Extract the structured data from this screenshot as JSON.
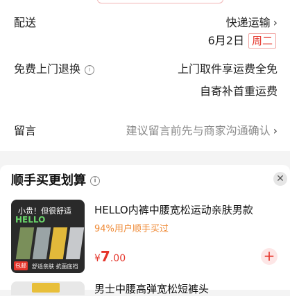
{
  "shipping": {
    "label": "配送",
    "method": "快递运输",
    "date": "6月2日",
    "weekday": "周二"
  },
  "return_service": {
    "label": "免费上门退换",
    "line1": "上门取件享运费全免",
    "line2": "自寄补首重运费"
  },
  "message": {
    "label": "留言",
    "placeholder": "建议留言前先与商家沟通确认"
  },
  "recommend": {
    "title": "顺手买更划算",
    "items": [
      {
        "title": "HELLO内裤中腰宽松运动亲肤男款",
        "subtitle": "94%用户顺手买过",
        "price_currency": "¥",
        "price_int": "7",
        "price_dec": ".00",
        "thumb": {
          "tag_top": "小贵！但很舒适",
          "brand": "HELLO",
          "tag_bottom": "舒适亲肤 抗菌底裆",
          "stamp": "包邮"
        }
      },
      {
        "title": "男士中腰高弹宽松短裤头"
      }
    ]
  },
  "icons": {
    "chevron": "chevron-right-icon",
    "info": "info-icon",
    "close": "close-icon",
    "add": "plus-icon"
  },
  "colors": {
    "accent_red": "#e5352b",
    "orange_text": "#ef8a36",
    "hint_gray": "#8a8a8a"
  }
}
